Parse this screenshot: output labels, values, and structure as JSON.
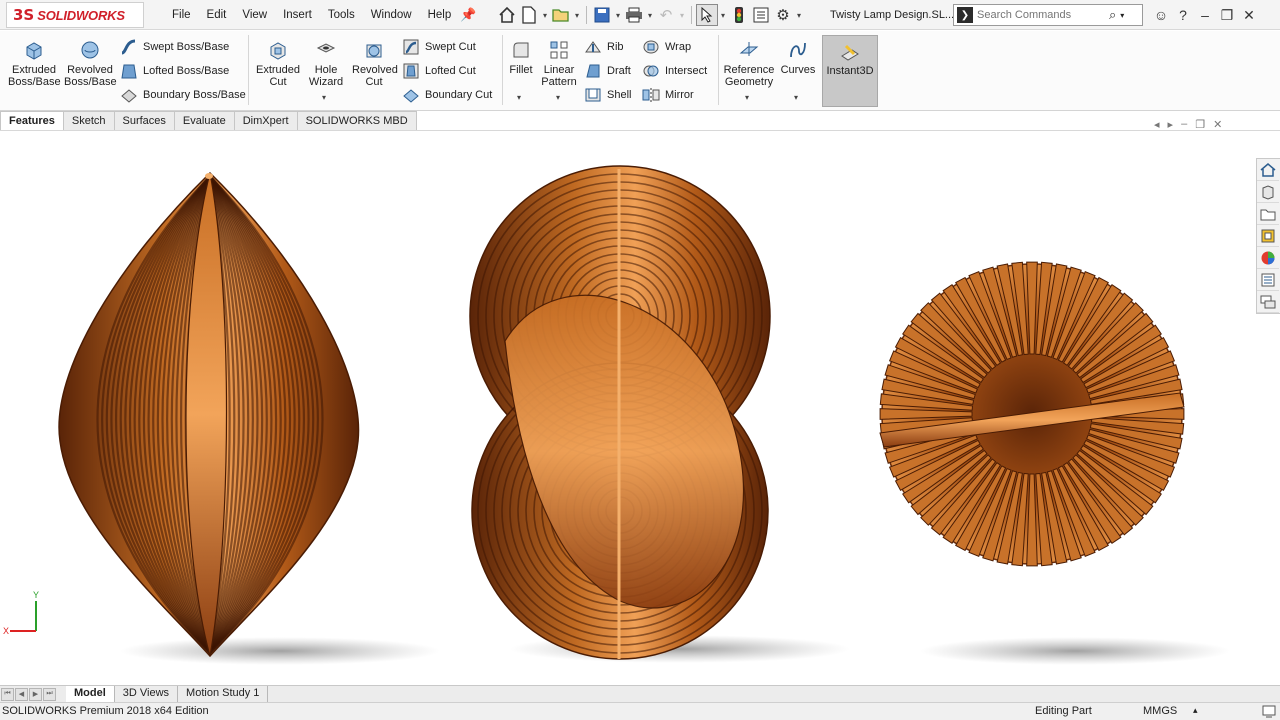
{
  "app": {
    "logo_mark": "3S",
    "logo_text": "SOLIDWORKS",
    "document_title": "Twisty Lamp Design.SL...",
    "menus": [
      "File",
      "Edit",
      "View",
      "Insert",
      "Tools",
      "Window",
      "Help"
    ]
  },
  "search": {
    "placeholder": "Search Commands"
  },
  "quick_access": [
    "home-icon",
    "new-document-icon",
    "open-icon",
    "save-icon",
    "print-icon",
    "undo-icon",
    "select-icon",
    "rebuild-icon",
    "file-properties-icon",
    "options-icon"
  ],
  "window_controls": [
    "user-icon",
    "help-icon",
    "minimize-icon",
    "restore-icon",
    "close-icon"
  ],
  "ribbon": {
    "extruded_boss": "Extruded Boss/Base",
    "revolved_boss": "Revolved Boss/Base",
    "swept_boss": "Swept Boss/Base",
    "lofted_boss": "Lofted Boss/Base",
    "boundary_boss": "Boundary Boss/Base",
    "extruded_cut": "Extruded Cut",
    "hole_wizard": "Hole Wizard",
    "revolved_cut": "Revolved Cut",
    "swept_cut": "Swept Cut",
    "lofted_cut": "Lofted Cut",
    "boundary_cut": "Boundary Cut",
    "fillet": "Fillet",
    "linear_pattern": "Linear Pattern",
    "rib": "Rib",
    "draft": "Draft",
    "shell": "Shell",
    "wrap": "Wrap",
    "intersect": "Intersect",
    "mirror": "Mirror",
    "reference_geometry": "Reference Geometry",
    "curves": "Curves",
    "instant3d": "Instant3D"
  },
  "command_tabs": [
    "Features",
    "Sketch",
    "Surfaces",
    "Evaluate",
    "DimXpert",
    "SOLIDWORKS MBD"
  ],
  "active_command_tab": "Features",
  "triad": {
    "x_label": "X",
    "y_label": "Y"
  },
  "bottom_tabs": [
    "Model",
    "3D Views",
    "Motion Study 1"
  ],
  "status": {
    "edition": "SOLIDWORKS Premium 2018 x64 Edition",
    "mode": "Editing Part",
    "units": "MMGS"
  },
  "colors": {
    "accent": "#d0202a",
    "copper_dark": "#6a2c0a",
    "copper_mid": "#b05a18",
    "copper_light": "#e8964a"
  }
}
